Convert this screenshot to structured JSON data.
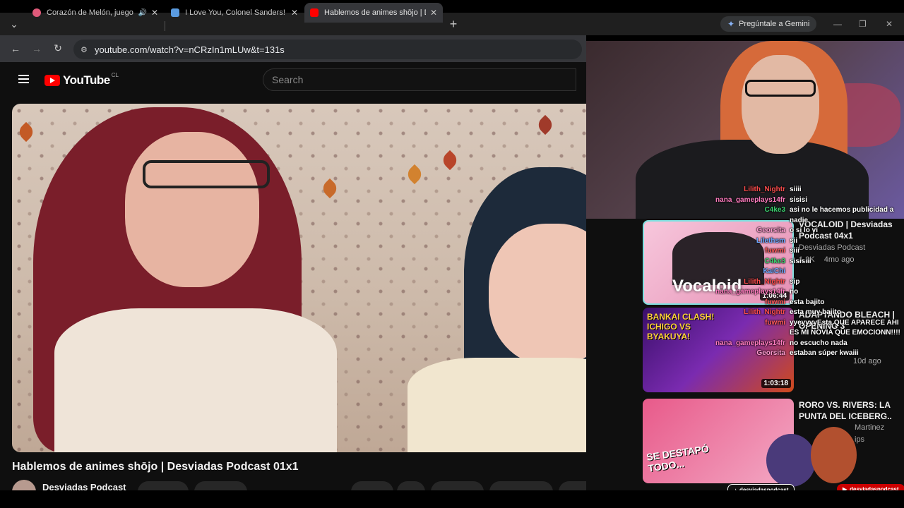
{
  "browser": {
    "tabs": [
      {
        "title": "Corazón de Melón, juego d",
        "favicon_color": "#e05a7a"
      },
      {
        "title": "I Love You, Colonel Sanders! A",
        "favicon_color": "#5a9be0"
      },
      {
        "title": "Hablemos de animes shōjo | De",
        "favicon_color": "#ff0000"
      }
    ],
    "new_tab": "+",
    "gemini_label": "Pregúntale a Gemini",
    "url": "youtube.com/watch?v=nCRzIn1mLUw&t=131s"
  },
  "youtube": {
    "logo_text": "YouTube",
    "region": "CL",
    "search_placeholder": "Search",
    "video_title": "Hablemos de animes shōjo | Desviadas Podcast 01x1",
    "channel": "Desviadas Podcast"
  },
  "recommendations": [
    {
      "title": "VOCALOID | Desviadas Podcast 04x1",
      "channel": "Desviadas Podcast",
      "views": "1.2K",
      "age": "4mo ago",
      "duration": "1:06:44",
      "thumb_text": "Vocaloid"
    },
    {
      "title": "ADAPTANDO BLEACH | OPENING 3",
      "meta": "10d ago",
      "duration": "1:03:18",
      "thumb_text": "BANKAI CLASH! ICHIGO VS BYAKUYA!"
    },
    {
      "title": "RORO VS. RIVERS: LA PUNTA DEL ICEBERG..",
      "channel": "Martinez",
      "meta": "ips",
      "thumb_text": "SE DESTAPÓ TODO..."
    }
  ],
  "chat": [
    {
      "nick": "Lilith_Nightr",
      "text": "siiii",
      "color": "#ff4d4d"
    },
    {
      "nick": "nana_gameplays14fr",
      "text": "sisisi",
      "color": "#ff7bbf"
    },
    {
      "nick": "C4ke3",
      "text": "asi no le hacemos publicidad a",
      "color": "#3bd16f"
    },
    {
      "nick": "",
      "text": "nadie",
      "color": "#fff"
    },
    {
      "nick": "Georsita",
      "text": "o si lo vi",
      "color": "#ff9bd0"
    },
    {
      "nick": "Lilethsm",
      "text": "sii",
      "color": "#6aa8ff"
    },
    {
      "nick": "fuwmi",
      "text": "siii",
      "color": "#ff5a5a"
    },
    {
      "nick": "C4ke3",
      "text": "sisisiii",
      "color": "#3bd16f"
    },
    {
      "nick": "KaiChi",
      "text": "",
      "color": "#6aa8ff"
    },
    {
      "nick": "Lilith_Nightr",
      "text": "sip",
      "color": "#ff4d4d"
    },
    {
      "nick": "nana_gameplays14fr",
      "text": "no",
      "color": "#ff7bbf"
    },
    {
      "nick": "fuwmi",
      "text": "esta bajito",
      "color": "#ff5a5a"
    },
    {
      "nick": "Lilith_Nightr",
      "text": "esta muy bajito",
      "color": "#ff4d4d"
    },
    {
      "nick": "fuwmi",
      "text": "yyeyyyyEsta QUE APARECE AHI",
      "color": "#ff5a5a"
    },
    {
      "nick": "",
      "text": "ES MI NOVIA QUE EMOCIONN!!!!",
      "color": "#fff"
    },
    {
      "nick": "nana_gameplays14fr",
      "text": "no escucho nada",
      "color": "#ff7bbf"
    },
    {
      "nick": "Georsita",
      "text": "estaban súper kwaiii",
      "color": "#ff9bd0"
    }
  ],
  "socials": [
    {
      "handle": "desviadaspodcast",
      "platform": "tiktok",
      "color": "#111111"
    },
    {
      "handle": "desviadaspodcast",
      "platform": "youtube",
      "color": "#cc0000"
    }
  ]
}
